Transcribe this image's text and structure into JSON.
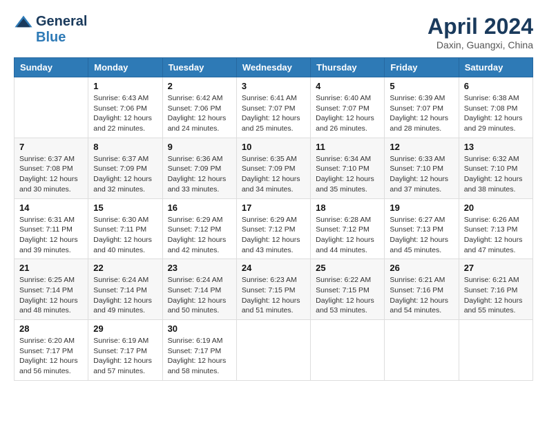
{
  "header": {
    "logo_general": "General",
    "logo_blue": "Blue",
    "title": "April 2024",
    "location": "Daxin, Guangxi, China"
  },
  "weekdays": [
    "Sunday",
    "Monday",
    "Tuesday",
    "Wednesday",
    "Thursday",
    "Friday",
    "Saturday"
  ],
  "weeks": [
    [
      {
        "day": "",
        "sunrise": "",
        "sunset": "",
        "daylight": ""
      },
      {
        "day": "1",
        "sunrise": "Sunrise: 6:43 AM",
        "sunset": "Sunset: 7:06 PM",
        "daylight": "Daylight: 12 hours and 22 minutes."
      },
      {
        "day": "2",
        "sunrise": "Sunrise: 6:42 AM",
        "sunset": "Sunset: 7:06 PM",
        "daylight": "Daylight: 12 hours and 24 minutes."
      },
      {
        "day": "3",
        "sunrise": "Sunrise: 6:41 AM",
        "sunset": "Sunset: 7:07 PM",
        "daylight": "Daylight: 12 hours and 25 minutes."
      },
      {
        "day": "4",
        "sunrise": "Sunrise: 6:40 AM",
        "sunset": "Sunset: 7:07 PM",
        "daylight": "Daylight: 12 hours and 26 minutes."
      },
      {
        "day": "5",
        "sunrise": "Sunrise: 6:39 AM",
        "sunset": "Sunset: 7:07 PM",
        "daylight": "Daylight: 12 hours and 28 minutes."
      },
      {
        "day": "6",
        "sunrise": "Sunrise: 6:38 AM",
        "sunset": "Sunset: 7:08 PM",
        "daylight": "Daylight: 12 hours and 29 minutes."
      }
    ],
    [
      {
        "day": "7",
        "sunrise": "Sunrise: 6:37 AM",
        "sunset": "Sunset: 7:08 PM",
        "daylight": "Daylight: 12 hours and 30 minutes."
      },
      {
        "day": "8",
        "sunrise": "Sunrise: 6:37 AM",
        "sunset": "Sunset: 7:09 PM",
        "daylight": "Daylight: 12 hours and 32 minutes."
      },
      {
        "day": "9",
        "sunrise": "Sunrise: 6:36 AM",
        "sunset": "Sunset: 7:09 PM",
        "daylight": "Daylight: 12 hours and 33 minutes."
      },
      {
        "day": "10",
        "sunrise": "Sunrise: 6:35 AM",
        "sunset": "Sunset: 7:09 PM",
        "daylight": "Daylight: 12 hours and 34 minutes."
      },
      {
        "day": "11",
        "sunrise": "Sunrise: 6:34 AM",
        "sunset": "Sunset: 7:10 PM",
        "daylight": "Daylight: 12 hours and 35 minutes."
      },
      {
        "day": "12",
        "sunrise": "Sunrise: 6:33 AM",
        "sunset": "Sunset: 7:10 PM",
        "daylight": "Daylight: 12 hours and 37 minutes."
      },
      {
        "day": "13",
        "sunrise": "Sunrise: 6:32 AM",
        "sunset": "Sunset: 7:10 PM",
        "daylight": "Daylight: 12 hours and 38 minutes."
      }
    ],
    [
      {
        "day": "14",
        "sunrise": "Sunrise: 6:31 AM",
        "sunset": "Sunset: 7:11 PM",
        "daylight": "Daylight: 12 hours and 39 minutes."
      },
      {
        "day": "15",
        "sunrise": "Sunrise: 6:30 AM",
        "sunset": "Sunset: 7:11 PM",
        "daylight": "Daylight: 12 hours and 40 minutes."
      },
      {
        "day": "16",
        "sunrise": "Sunrise: 6:29 AM",
        "sunset": "Sunset: 7:12 PM",
        "daylight": "Daylight: 12 hours and 42 minutes."
      },
      {
        "day": "17",
        "sunrise": "Sunrise: 6:29 AM",
        "sunset": "Sunset: 7:12 PM",
        "daylight": "Daylight: 12 hours and 43 minutes."
      },
      {
        "day": "18",
        "sunrise": "Sunrise: 6:28 AM",
        "sunset": "Sunset: 7:12 PM",
        "daylight": "Daylight: 12 hours and 44 minutes."
      },
      {
        "day": "19",
        "sunrise": "Sunrise: 6:27 AM",
        "sunset": "Sunset: 7:13 PM",
        "daylight": "Daylight: 12 hours and 45 minutes."
      },
      {
        "day": "20",
        "sunrise": "Sunrise: 6:26 AM",
        "sunset": "Sunset: 7:13 PM",
        "daylight": "Daylight: 12 hours and 47 minutes."
      }
    ],
    [
      {
        "day": "21",
        "sunrise": "Sunrise: 6:25 AM",
        "sunset": "Sunset: 7:14 PM",
        "daylight": "Daylight: 12 hours and 48 minutes."
      },
      {
        "day": "22",
        "sunrise": "Sunrise: 6:24 AM",
        "sunset": "Sunset: 7:14 PM",
        "daylight": "Daylight: 12 hours and 49 minutes."
      },
      {
        "day": "23",
        "sunrise": "Sunrise: 6:24 AM",
        "sunset": "Sunset: 7:14 PM",
        "daylight": "Daylight: 12 hours and 50 minutes."
      },
      {
        "day": "24",
        "sunrise": "Sunrise: 6:23 AM",
        "sunset": "Sunset: 7:15 PM",
        "daylight": "Daylight: 12 hours and 51 minutes."
      },
      {
        "day": "25",
        "sunrise": "Sunrise: 6:22 AM",
        "sunset": "Sunset: 7:15 PM",
        "daylight": "Daylight: 12 hours and 53 minutes."
      },
      {
        "day": "26",
        "sunrise": "Sunrise: 6:21 AM",
        "sunset": "Sunset: 7:16 PM",
        "daylight": "Daylight: 12 hours and 54 minutes."
      },
      {
        "day": "27",
        "sunrise": "Sunrise: 6:21 AM",
        "sunset": "Sunset: 7:16 PM",
        "daylight": "Daylight: 12 hours and 55 minutes."
      }
    ],
    [
      {
        "day": "28",
        "sunrise": "Sunrise: 6:20 AM",
        "sunset": "Sunset: 7:17 PM",
        "daylight": "Daylight: 12 hours and 56 minutes."
      },
      {
        "day": "29",
        "sunrise": "Sunrise: 6:19 AM",
        "sunset": "Sunset: 7:17 PM",
        "daylight": "Daylight: 12 hours and 57 minutes."
      },
      {
        "day": "30",
        "sunrise": "Sunrise: 6:19 AM",
        "sunset": "Sunset: 7:17 PM",
        "daylight": "Daylight: 12 hours and 58 minutes."
      },
      {
        "day": "",
        "sunrise": "",
        "sunset": "",
        "daylight": ""
      },
      {
        "day": "",
        "sunrise": "",
        "sunset": "",
        "daylight": ""
      },
      {
        "day": "",
        "sunrise": "",
        "sunset": "",
        "daylight": ""
      },
      {
        "day": "",
        "sunrise": "",
        "sunset": "",
        "daylight": ""
      }
    ]
  ]
}
